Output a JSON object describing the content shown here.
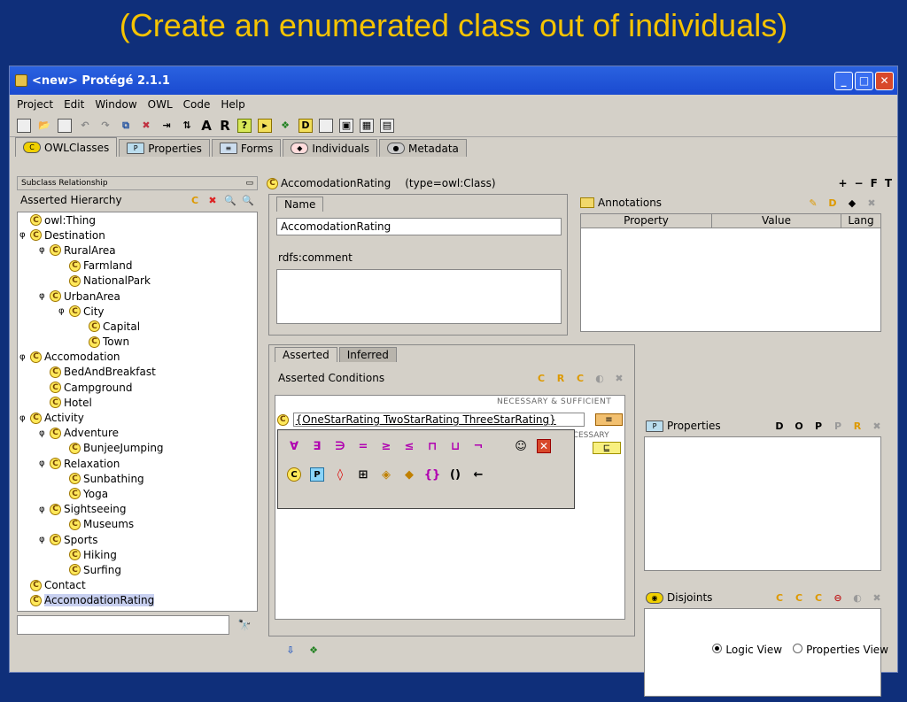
{
  "slide_title": "(Create an enumerated class out of individuals)",
  "window": {
    "title": "<new> Protégé 2.1.1"
  },
  "menu": [
    "Project",
    "Edit",
    "Window",
    "OWL",
    "Code",
    "Help"
  ],
  "toolbar_text": {
    "a": "A",
    "r": "R"
  },
  "tabs": [
    {
      "label": "OWLClasses"
    },
    {
      "label": "Properties"
    },
    {
      "label": "Forms"
    },
    {
      "label": "Individuals"
    },
    {
      "label": "Metadata"
    }
  ],
  "left": {
    "header": "Subclass Relationship",
    "sub": "Asserted Hierarchy",
    "tree": [
      {
        "label": "owl:Thing",
        "depth": 0,
        "exp": ""
      },
      {
        "label": "Destination",
        "depth": 0,
        "exp": "φ"
      },
      {
        "label": "RuralArea",
        "depth": 1,
        "exp": "φ"
      },
      {
        "label": "Farmland",
        "depth": 2,
        "exp": ""
      },
      {
        "label": "NationalPark",
        "depth": 2,
        "exp": ""
      },
      {
        "label": "UrbanArea",
        "depth": 1,
        "exp": "φ"
      },
      {
        "label": "City",
        "depth": 2,
        "exp": "φ"
      },
      {
        "label": "Capital",
        "depth": 3,
        "exp": ""
      },
      {
        "label": "Town",
        "depth": 3,
        "exp": ""
      },
      {
        "label": "Accomodation",
        "depth": 0,
        "exp": "φ"
      },
      {
        "label": "BedAndBreakfast",
        "depth": 1,
        "exp": ""
      },
      {
        "label": "Campground",
        "depth": 1,
        "exp": ""
      },
      {
        "label": "Hotel",
        "depth": 1,
        "exp": ""
      },
      {
        "label": "Activity",
        "depth": 0,
        "exp": "φ"
      },
      {
        "label": "Adventure",
        "depth": 1,
        "exp": "φ"
      },
      {
        "label": "BunjeeJumping",
        "depth": 2,
        "exp": ""
      },
      {
        "label": "Relaxation",
        "depth": 1,
        "exp": "φ"
      },
      {
        "label": "Sunbathing",
        "depth": 2,
        "exp": ""
      },
      {
        "label": "Yoga",
        "depth": 2,
        "exp": ""
      },
      {
        "label": "Sightseeing",
        "depth": 1,
        "exp": "φ"
      },
      {
        "label": "Museums",
        "depth": 2,
        "exp": ""
      },
      {
        "label": "Sports",
        "depth": 1,
        "exp": "φ"
      },
      {
        "label": "Hiking",
        "depth": 2,
        "exp": ""
      },
      {
        "label": "Surfing",
        "depth": 2,
        "exp": ""
      },
      {
        "label": "Contact",
        "depth": 0,
        "exp": ""
      },
      {
        "label": "AccomodationRating",
        "depth": 0,
        "exp": "",
        "selected": true
      }
    ]
  },
  "class_header": {
    "name": "AccomodationRating",
    "type": "(type=owl:Class)",
    "actions": [
      "+",
      "−",
      "F",
      "T"
    ]
  },
  "name_panel": {
    "tab": "Name",
    "value": "AccomodationRating",
    "rdfs": "rdfs:comment"
  },
  "annotations": {
    "title": "Annotations",
    "columns": [
      "Property",
      "Value",
      "Lang"
    ]
  },
  "conditions": {
    "tabs": [
      "Asserted",
      "Inferred"
    ],
    "title": "Asserted Conditions",
    "ns": "NECESSARY & SUFFICIENT",
    "necessary": "ECESSARY",
    "edit_value": "{OneStarRating TwoStarRating ThreeStarRating}",
    "eq": "≡",
    "sub": "⊑"
  },
  "popup": {
    "row1": [
      "∀",
      "∃",
      "∋",
      "=",
      "≥",
      "≤",
      "⊓",
      "⊔",
      "¬"
    ],
    "row2": [
      "C",
      "P",
      "◊",
      "⊞",
      "◈",
      "◆",
      "{}",
      "()",
      "←"
    ]
  },
  "properties_panel": {
    "title": "Properties"
  },
  "disjoints_panel": {
    "title": "Disjoints"
  },
  "views": {
    "logic": "Logic View",
    "properties": "Properties View"
  }
}
